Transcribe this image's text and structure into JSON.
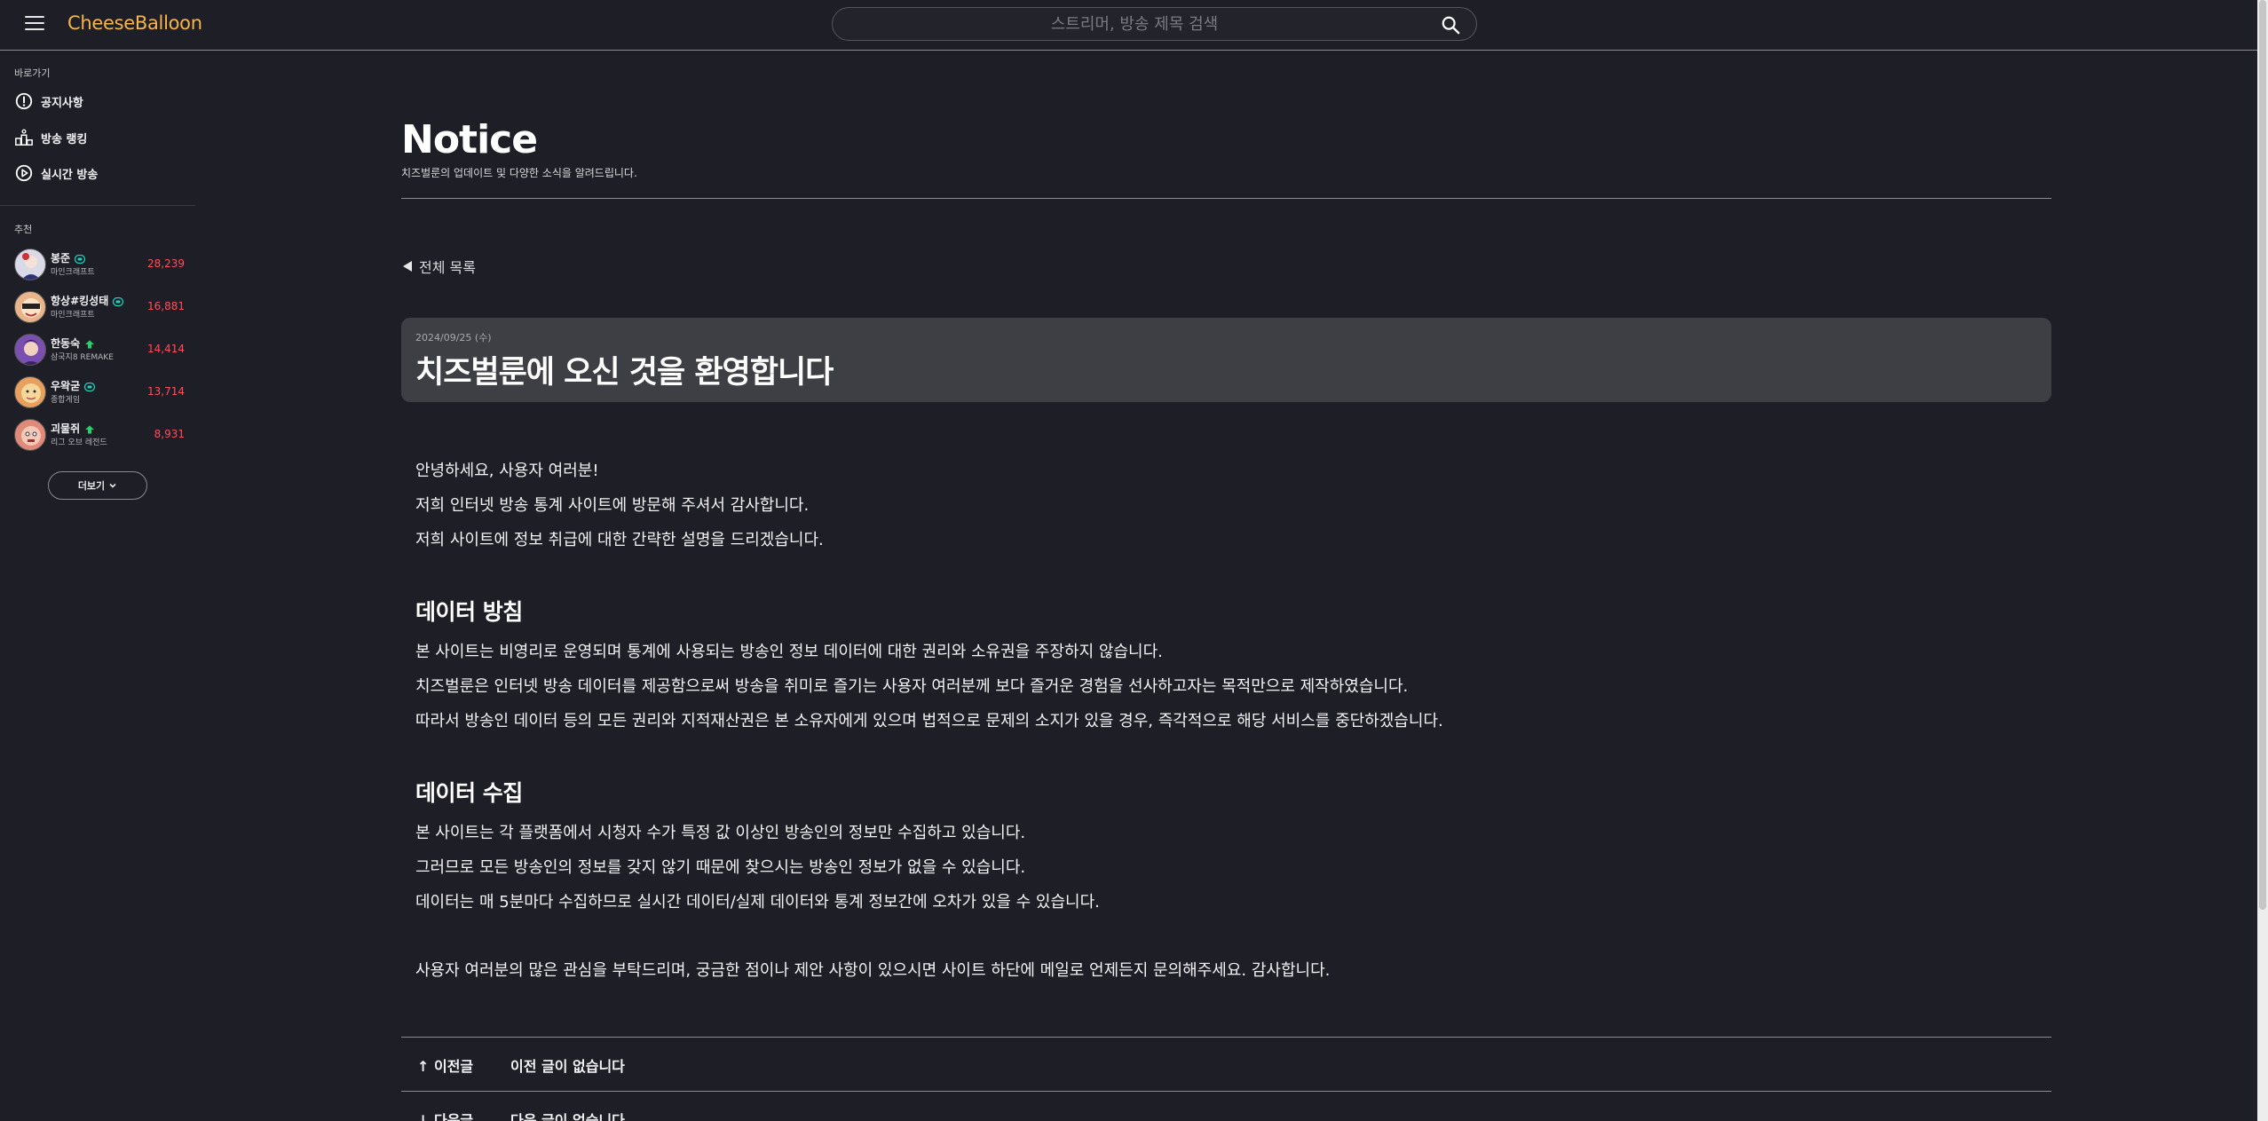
{
  "header": {
    "logo": "CheeseBalloon",
    "search_placeholder": "스트리머, 방송 제목 검색"
  },
  "sidebar": {
    "shortcuts_label": "바로가기",
    "nav": [
      {
        "label": "공지사항",
        "icon": "exclamation-circle-icon"
      },
      {
        "label": "방송 랭킹",
        "icon": "podium-icon"
      },
      {
        "label": "실시간 방송",
        "icon": "play-circle-icon"
      }
    ],
    "recommend_label": "추천",
    "streamers": [
      {
        "name": "봉준",
        "category": "마인크래프트",
        "viewers": "28,239",
        "platform": "chzzk",
        "avatar_color": "#d9d9e8"
      },
      {
        "name": "항상#킹성태",
        "category": "마인크래프트",
        "viewers": "16,881",
        "platform": "chzzk",
        "avatar_color": "#e9b48a"
      },
      {
        "name": "한동숙",
        "category": "삼국지8 REMAKE",
        "viewers": "14,414",
        "platform": "soop",
        "avatar_color": "#7b4fb0"
      },
      {
        "name": "우왁굳",
        "category": "종합게임",
        "viewers": "13,714",
        "platform": "chzzk",
        "avatar_color": "#e8a060"
      },
      {
        "name": "괴물쥐",
        "category": "리그 오브 레전드",
        "viewers": "8,931",
        "platform": "soop",
        "avatar_color": "#e08a7a"
      }
    ],
    "more_label": "더보기"
  },
  "main": {
    "title": "Notice",
    "subtitle": "치즈벌룬의 업데이트 및 다양한 소식을 알려드립니다.",
    "back_label": "전체 목록",
    "post": {
      "date": "2024/09/25 (수)",
      "title": "치즈벌룬에 오신 것을 환영합니다",
      "intro": [
        "안녕하세요, 사용자 여러분!",
        "저희 인터넷 방송 통계 사이트에 방문해 주셔서 감사합니다.",
        "저희 사이트에 정보 취급에 대한 간략한 설명을 드리겠습니다."
      ],
      "section1_heading": "데이터 방침",
      "section1": [
        "본 사이트는 비영리로 운영되며 통계에 사용되는 방송인 정보 데이터에 대한 권리와 소유권을 주장하지 않습니다.",
        "치즈벌룬은 인터넷 방송 데이터를 제공함으로써 방송을 취미로 즐기는 사용자 여러분께 보다 즐거운 경험을 선사하고자는 목적만으로 제작하였습니다.",
        "따라서 방송인 데이터 등의 모든 권리와 지적재산권은 본 소유자에게 있으며 법적으로 문제의 소지가 있을 경우, 즉각적으로 해당 서비스를 중단하겠습니다."
      ],
      "section2_heading": "데이터 수집",
      "section2": [
        "본 사이트는 각 플랫폼에서 시청자 수가 특정 값 이상인 방송인의 정보만 수집하고 있습니다.",
        "그러므로 모든 방송인의 정보를 갖지 않기 때문에 찾으시는 방송인 정보가 없을 수 있습니다.",
        "데이터는 매 5분마다 수집하므로 실시간 데이터/실제 데이터와 통계 정보간에 오차가 있을 수 있습니다."
      ],
      "closing": "사용자 여러분의 많은 관심을 부탁드리며, 궁금한 점이나 제안 사항이 있으시면 사이트 하단에 메일로 언제든지 문의해주세요. 감사합니다."
    },
    "prev": {
      "label": "↑ 이전글",
      "value": "이전 글이 없습니다"
    },
    "next": {
      "label": "↓ 다음글",
      "value": "다음 글이 없습니다"
    }
  }
}
